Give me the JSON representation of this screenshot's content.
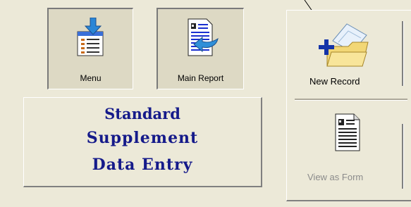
{
  "toolbar": {
    "menu_label": "Menu",
    "main_report_label": "Main Report"
  },
  "title": {
    "line1": "Standard",
    "line2": "Supplement",
    "line3": "Data Entry"
  },
  "panel": {
    "new_record_label": "New Record",
    "view_as_form_label": "View as Form"
  },
  "colors": {
    "background": "#ece9d8",
    "title_text": "#151a8a",
    "disabled_text": "#8b8b8b"
  }
}
